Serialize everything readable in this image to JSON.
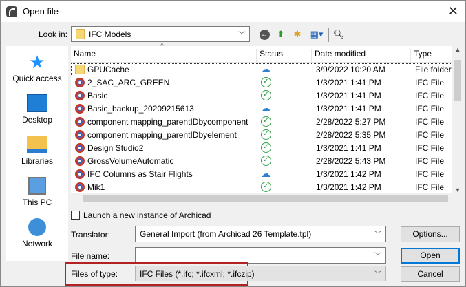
{
  "window": {
    "title": "Open file",
    "close": "✕"
  },
  "lookin": {
    "label": "Look in:",
    "value": "IFC Models"
  },
  "sidebar": [
    {
      "label": "Quick access"
    },
    {
      "label": "Desktop"
    },
    {
      "label": "Libraries"
    },
    {
      "label": "This PC"
    },
    {
      "label": "Network"
    }
  ],
  "columns": {
    "name": "Name",
    "status": "Status",
    "date": "Date modified",
    "type": "Type"
  },
  "files": [
    {
      "name": "GPUCache",
      "status": "cloud",
      "date": "3/9/2022 10:20 AM",
      "type": "File folder",
      "kind": "folder"
    },
    {
      "name": "2_SAC_ARC_GREEN",
      "status": "synced",
      "date": "1/3/2021 1:41 PM",
      "type": "IFC File",
      "kind": "ifc"
    },
    {
      "name": "Basic",
      "status": "synced",
      "date": "1/3/2021 1:41 PM",
      "type": "IFC File",
      "kind": "ifc"
    },
    {
      "name": "Basic_backup_20209215613",
      "status": "cloud",
      "date": "1/3/2021 1:41 PM",
      "type": "IFC File",
      "kind": "ifc"
    },
    {
      "name": "component mapping_parentIDbycomponent",
      "status": "synced",
      "date": "2/28/2022 5:27 PM",
      "type": "IFC File",
      "kind": "ifc"
    },
    {
      "name": "component mapping_parentIDbyelement",
      "status": "synced",
      "date": "2/28/2022 5:35 PM",
      "type": "IFC File",
      "kind": "ifc"
    },
    {
      "name": "Design Studio2",
      "status": "synced",
      "date": "1/3/2021 1:41 PM",
      "type": "IFC File",
      "kind": "ifc"
    },
    {
      "name": "GrossVolumeAutomatic",
      "status": "synced",
      "date": "2/28/2022 5:43 PM",
      "type": "IFC File",
      "kind": "ifc"
    },
    {
      "name": "IFC Columns as Stair Flights",
      "status": "cloud",
      "date": "1/3/2021 1:42 PM",
      "type": "IFC File",
      "kind": "ifc"
    },
    {
      "name": "Mik1",
      "status": "synced",
      "date": "1/3/2021 1:42 PM",
      "type": "IFC File",
      "kind": "ifc"
    }
  ],
  "launch": {
    "label": "Launch a new instance of Archicad",
    "checked": false
  },
  "translator": {
    "label": "Translator:",
    "value": "General Import (from Archicad 26 Template.tpl)"
  },
  "filename": {
    "label": "File name:",
    "value": ""
  },
  "filetype": {
    "label": "Files of type:",
    "value": "IFC Files (*.ifc; *.ifcxml; *.ifczip)"
  },
  "buttons": {
    "options": "Options...",
    "open": "Open",
    "cancel": "Cancel"
  },
  "colors": {
    "highlight": "#b22222",
    "accent": "#0078d7"
  }
}
